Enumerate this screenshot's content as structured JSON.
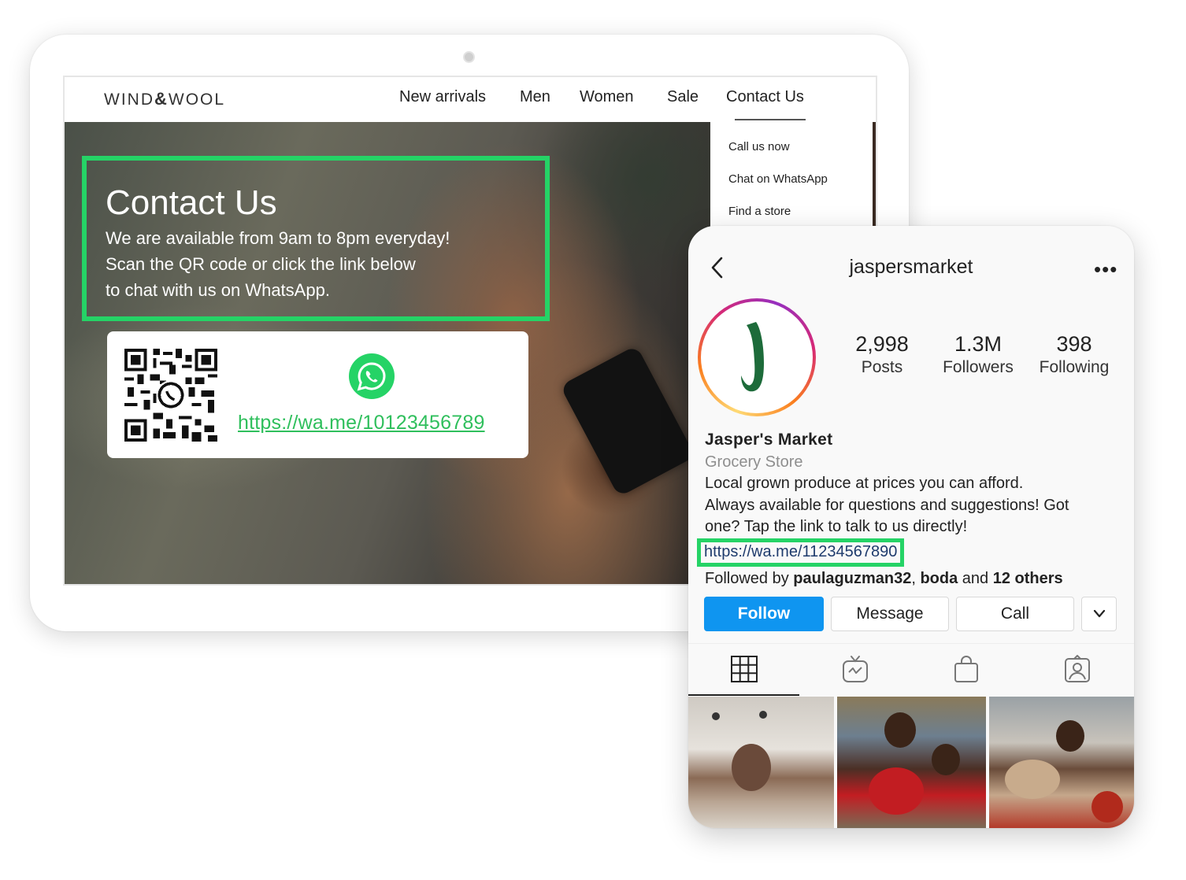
{
  "website": {
    "brand": {
      "left": "WIND",
      "amp": "&",
      "right": "WOOL"
    },
    "nav": [
      {
        "label": "New arrivals"
      },
      {
        "label": "Men"
      },
      {
        "label": "Women"
      },
      {
        "label": "Sale"
      },
      {
        "label": "Contact Us"
      }
    ],
    "dropdown": [
      {
        "label": "Call us now"
      },
      {
        "label": "Chat on WhatsApp"
      },
      {
        "label": "Find a store"
      }
    ],
    "contact": {
      "title": "Contact Us",
      "line1": "We are available from 9am to 8pm everyday!",
      "line2": "Scan the QR code or click the link below",
      "line3": "to chat with us on WhatsApp."
    },
    "whatsapp_link": "https://wa.me/10123456789",
    "icons": [
      "qr-code-icon",
      "whatsapp-icon"
    ],
    "colors": {
      "highlight": "#25d366",
      "link": "#2fbf5c"
    }
  },
  "instagram": {
    "username": "jaspersmarket",
    "stats": [
      {
        "value": "2,998",
        "label": "Posts"
      },
      {
        "value": "1.3M",
        "label": "Followers"
      },
      {
        "value": "398",
        "label": "Following"
      }
    ],
    "profile": {
      "name": "Jasper's Market",
      "category": "Grocery Store",
      "bio_line1": "Local grown produce at prices you can afford.",
      "bio_line2": "Always available for questions and suggestions! Got",
      "bio_line3": "one? Tap the link to talk to us directly!",
      "link": "https://wa.me/11234567890",
      "followed_prefix": "Followed by ",
      "followed_user1": "paulaguzman32",
      "followed_sep": ", ",
      "followed_user2": "boda",
      "followed_and": " and ",
      "followed_others": "12 others"
    },
    "buttons": {
      "follow": "Follow",
      "message": "Message",
      "call": "Call"
    },
    "tabs": [
      "grid-icon",
      "igtv-icon",
      "shop-icon",
      "tagged-icon"
    ],
    "colors": {
      "follow": "#0f95f0",
      "link": "#1e3b6d",
      "highlight": "#25d366"
    }
  }
}
